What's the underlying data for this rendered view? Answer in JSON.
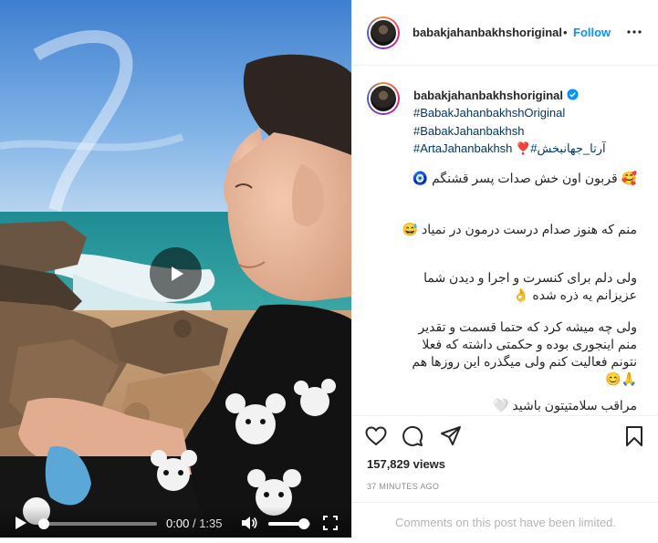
{
  "video": {
    "current_time": "0:00",
    "separator": "/",
    "duration": "1:35",
    "progress_fraction": 0.0,
    "volume_fraction": 0.85
  },
  "header": {
    "username": "babakjahanbakhshoriginal",
    "dot": "•",
    "follow_label": "Follow"
  },
  "caption": {
    "username": "babakjahanbakhshoriginal",
    "hashtags": [
      "#BabakJahanbakhshOriginal",
      "#BabakJahanbakhsh",
      "#ArtaJahanbakhsh ❣️#آرتا_جهانبخش"
    ],
    "lines": [
      "🥰 قربون اون خش صدات پسر قشنگم 🧿",
      "منم که هنوز صدام درست درمون در نمیاد 😅",
      "ولی دلم برای کنسرت و اجرا و دیدن شما عزیزانم یه ذره شده 👌",
      "ولی چه میشه کرد که حتما قسمت و تقدیر منم اینجوری بوده و حکمتی داشته که فعلا نتونم فعالیت کنم ولی میگذره این روزها هم 🙏😊",
      "مراقب سلامتیتون باشید 🤍"
    ]
  },
  "stats": {
    "views": "157,829 views",
    "time_ago": "37 MINUTES AGO"
  },
  "footer": {
    "comments_limited": "Comments on this post have been limited."
  },
  "colors": {
    "link_blue": "#0095f6",
    "verified_blue": "#0095f6",
    "hashtag": "#00376b"
  }
}
